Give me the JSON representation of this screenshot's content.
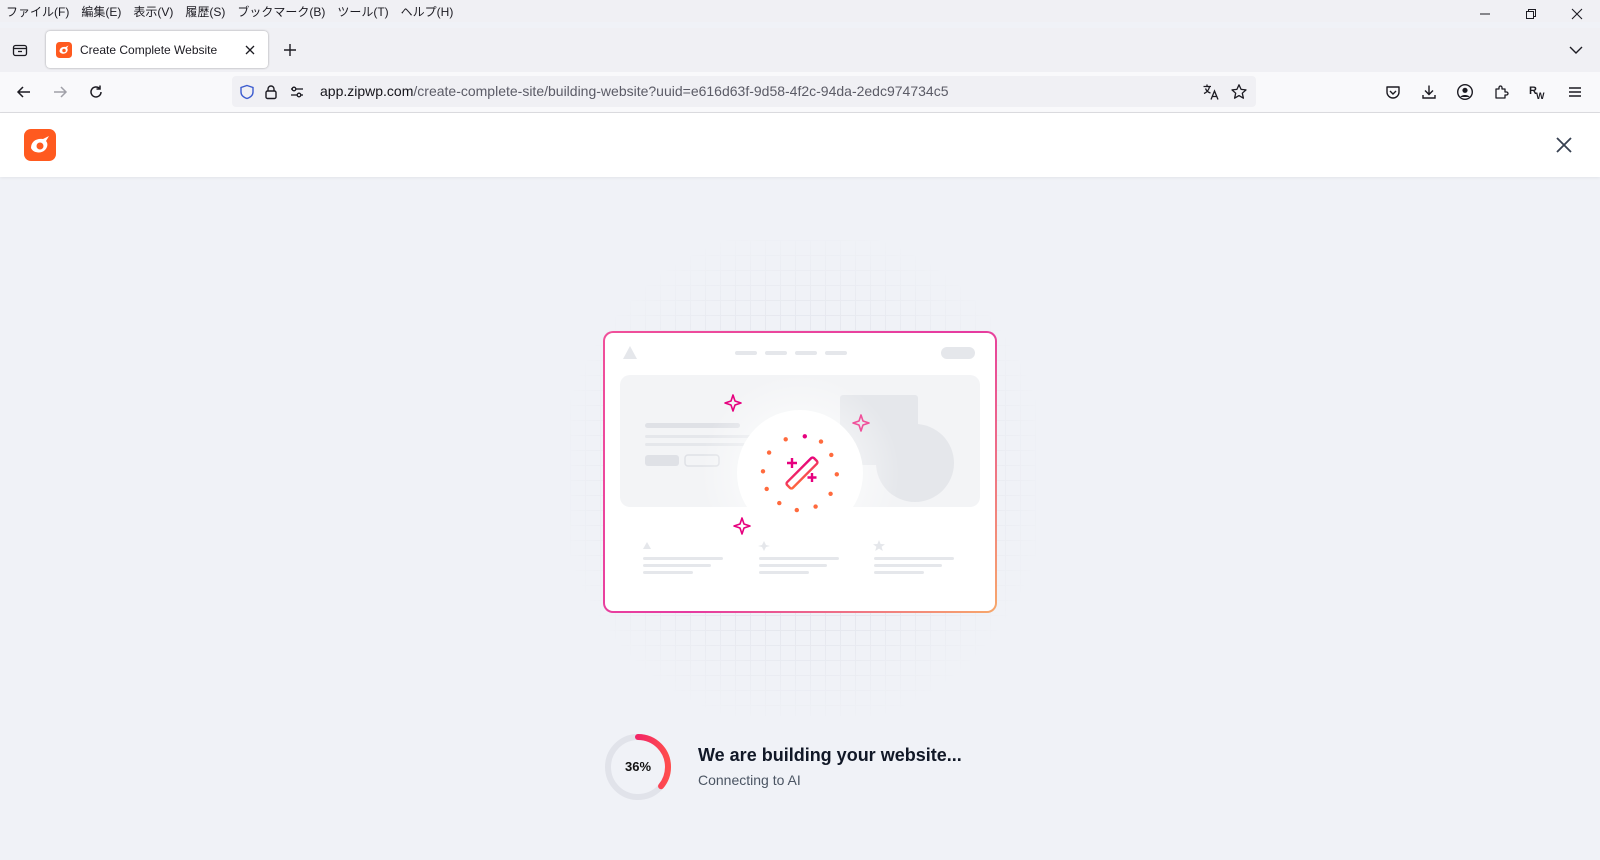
{
  "menubar": {
    "items": [
      "ファイル(F)",
      "編集(E)",
      "表示(V)",
      "履歴(S)",
      "ブックマーク(B)",
      "ツール(T)",
      "ヘルプ(H)"
    ]
  },
  "tab": {
    "title": "Create Complete Website"
  },
  "url": {
    "host": "app.zipwp.com",
    "path": "/create-complete-site/building-website?uuid=e616d63f-9d58-4f2c-94da-2edc974734c5"
  },
  "progress": {
    "percent_label": "36%",
    "value": 0.36
  },
  "status": {
    "title": "We are building your website...",
    "subtitle": "Connecting to AI"
  },
  "icons": {
    "brand": "zipwp-logo-icon",
    "brand_color": "#ff5a1f",
    "accent_pink": "#e6007e",
    "accent_orange": "#ff6a3d"
  }
}
